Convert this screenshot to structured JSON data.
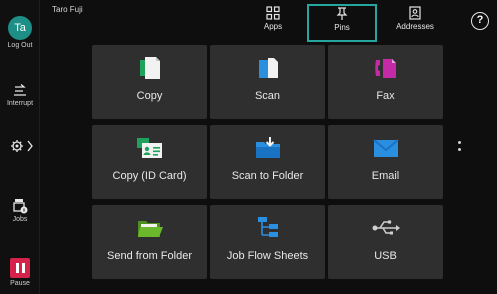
{
  "user": {
    "initials": "Ta",
    "name": "Taro Fuji"
  },
  "rail": {
    "logout_label": "Log Out",
    "interrupt_label": "Interrupt",
    "jobs_label": "Jobs",
    "pause_label": "Pause",
    "settings_chevron": "〉"
  },
  "tabs": [
    {
      "label": "Apps",
      "icon": "apps-grid-icon",
      "selected": false
    },
    {
      "label": "Pins",
      "icon": "pin-icon",
      "selected": true
    },
    {
      "label": "Addresses",
      "icon": "address-book-icon",
      "selected": false
    }
  ],
  "help_label": "?",
  "apps": [
    {
      "label": "Copy",
      "icon": "copy-icon",
      "color": "#1fa25b"
    },
    {
      "label": "Scan",
      "icon": "scan-icon",
      "color": "#2b8fe0"
    },
    {
      "label": "Fax",
      "icon": "fax-icon",
      "color": "#c42aa6"
    },
    {
      "label": "Copy (ID Card)",
      "icon": "id-card-copy-icon",
      "color": "#1fa25b"
    },
    {
      "label": "Scan to Folder",
      "icon": "scan-to-folder-icon",
      "color": "#2b8fe0"
    },
    {
      "label": "Email",
      "icon": "email-icon",
      "color": "#2b8fe0"
    },
    {
      "label": "Send from Folder",
      "icon": "send-from-folder-icon",
      "color": "#6bb82d"
    },
    {
      "label": "Job Flow Sheets",
      "icon": "job-flow-sheets-icon",
      "color": "#2b8fe0"
    },
    {
      "label": "USB",
      "icon": "usb-icon",
      "color": "#cfcfcf"
    }
  ]
}
